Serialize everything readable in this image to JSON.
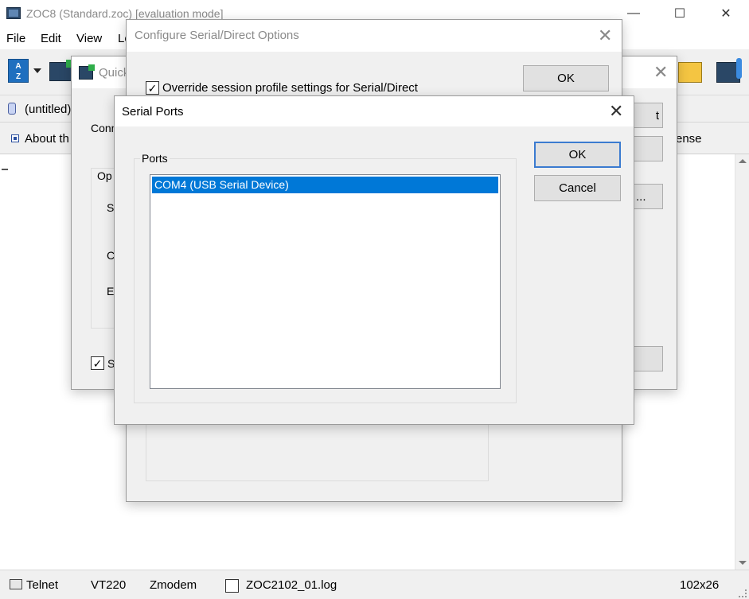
{
  "main_window": {
    "title": "ZOC8 (Standard.zoc) [evaluation mode]",
    "controls": {
      "minimize": "—",
      "maximize": "☐",
      "close": "✕"
    },
    "menu": [
      "File",
      "Edit",
      "View",
      "Lo"
    ],
    "tab_label": "(untitled)",
    "button_bar_first": "About th",
    "button_bar_last": "ense"
  },
  "status_bar": {
    "protocol": "Telnet",
    "emulation": "VT220",
    "transfer": "Zmodem",
    "logfile": "ZOC2102_01.log",
    "size": "102x26"
  },
  "quick_dialog": {
    "title": "Quick",
    "label_conn": "Conn",
    "group_op": "Op",
    "label_s": "S",
    "label_c": "C",
    "label_e": "E",
    "checkbox_s": "S",
    "btn_t": "t",
    "btn_dots": "..."
  },
  "configure_dialog": {
    "title": "Configure Serial/Direct Options",
    "override_checkbox": "Override session profile settings for Serial/Direct",
    "ok": "OK"
  },
  "serial_ports_dialog": {
    "title": "Serial Ports",
    "group_label": "Ports",
    "ports": [
      "COM4 (USB Serial Device)"
    ],
    "selected_index": 0,
    "ok": "OK",
    "cancel": "Cancel"
  },
  "colors": {
    "selection": "#0078d7",
    "dialog_bg": "#f0f0f0",
    "default_button_border": "#3b7bd0"
  }
}
